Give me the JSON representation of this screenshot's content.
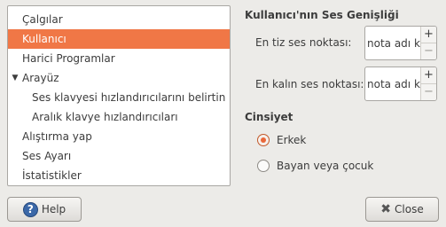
{
  "sidebar": {
    "items": [
      {
        "label": "Çalgılar"
      },
      {
        "label": "Kullanıcı"
      },
      {
        "label": "Harici Programlar"
      },
      {
        "label": "Arayüz",
        "expander": "▼"
      },
      {
        "label": "Ses klavyesi hızlandırıcılarını belirtin"
      },
      {
        "label": "Aralık klavye hızlandırıcıları"
      },
      {
        "label": "Alıştırma yap"
      },
      {
        "label": "Ses Ayarı"
      },
      {
        "label": "İstatistikler"
      }
    ]
  },
  "range": {
    "title": "Kullanıcı'nın Ses Genişliği",
    "lowest_label": "En tiz ses noktası:",
    "lowest_value": "nota adı k",
    "highest_label": "En kalın ses noktası:",
    "highest_value": "nota adı k",
    "spin_up": "+",
    "spin_down": "−"
  },
  "gender": {
    "title": "Cinsiyet",
    "options": [
      {
        "label": "Erkek",
        "checked": true
      },
      {
        "label": "Bayan veya çocuk",
        "checked": false
      }
    ]
  },
  "buttons": {
    "help_label": "Help",
    "help_glyph": "?",
    "close_label": "Close",
    "close_glyph": "✖"
  },
  "colors": {
    "selection": "#f07746",
    "radio_checked": "#e9683a"
  }
}
